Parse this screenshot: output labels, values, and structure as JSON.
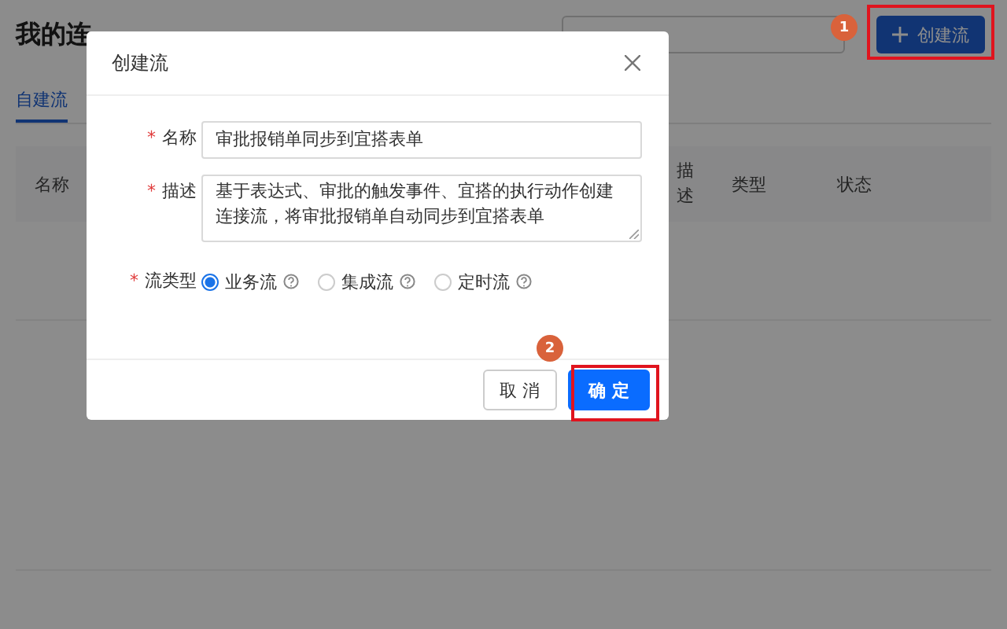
{
  "page": {
    "title": "我的连",
    "create_button": "创建流",
    "tabs": [
      {
        "label": "自建流",
        "selected": true
      }
    ],
    "table": {
      "columns": [
        "名称",
        "描述",
        "类型",
        "状态"
      ]
    }
  },
  "dialog": {
    "title": "创建流",
    "fields": [
      {
        "kind": "input",
        "label": "名称",
        "required_mark": "*",
        "value": "审批报销单同步到宜搭表单"
      },
      {
        "kind": "textarea",
        "label": "描述",
        "required_mark": "*",
        "value": "基于表达式、审批的触发事件、宜搭的执行动作创建连接流，将审批报销单自动同步到宜搭表单"
      },
      {
        "kind": "radio",
        "label": "流类型",
        "required_mark": "*",
        "options": [
          {
            "label": "业务流",
            "selected": true
          },
          {
            "label": "集成流",
            "selected": false
          },
          {
            "label": "定时流",
            "selected": false
          }
        ]
      }
    ],
    "buttons": [
      {
        "label": "取 消",
        "kind": "default"
      },
      {
        "label": "确 定",
        "kind": "primary"
      }
    ]
  },
  "annotations": [
    {
      "number": "1",
      "kind": "header"
    },
    {
      "number": "2",
      "kind": "footer"
    }
  ]
}
